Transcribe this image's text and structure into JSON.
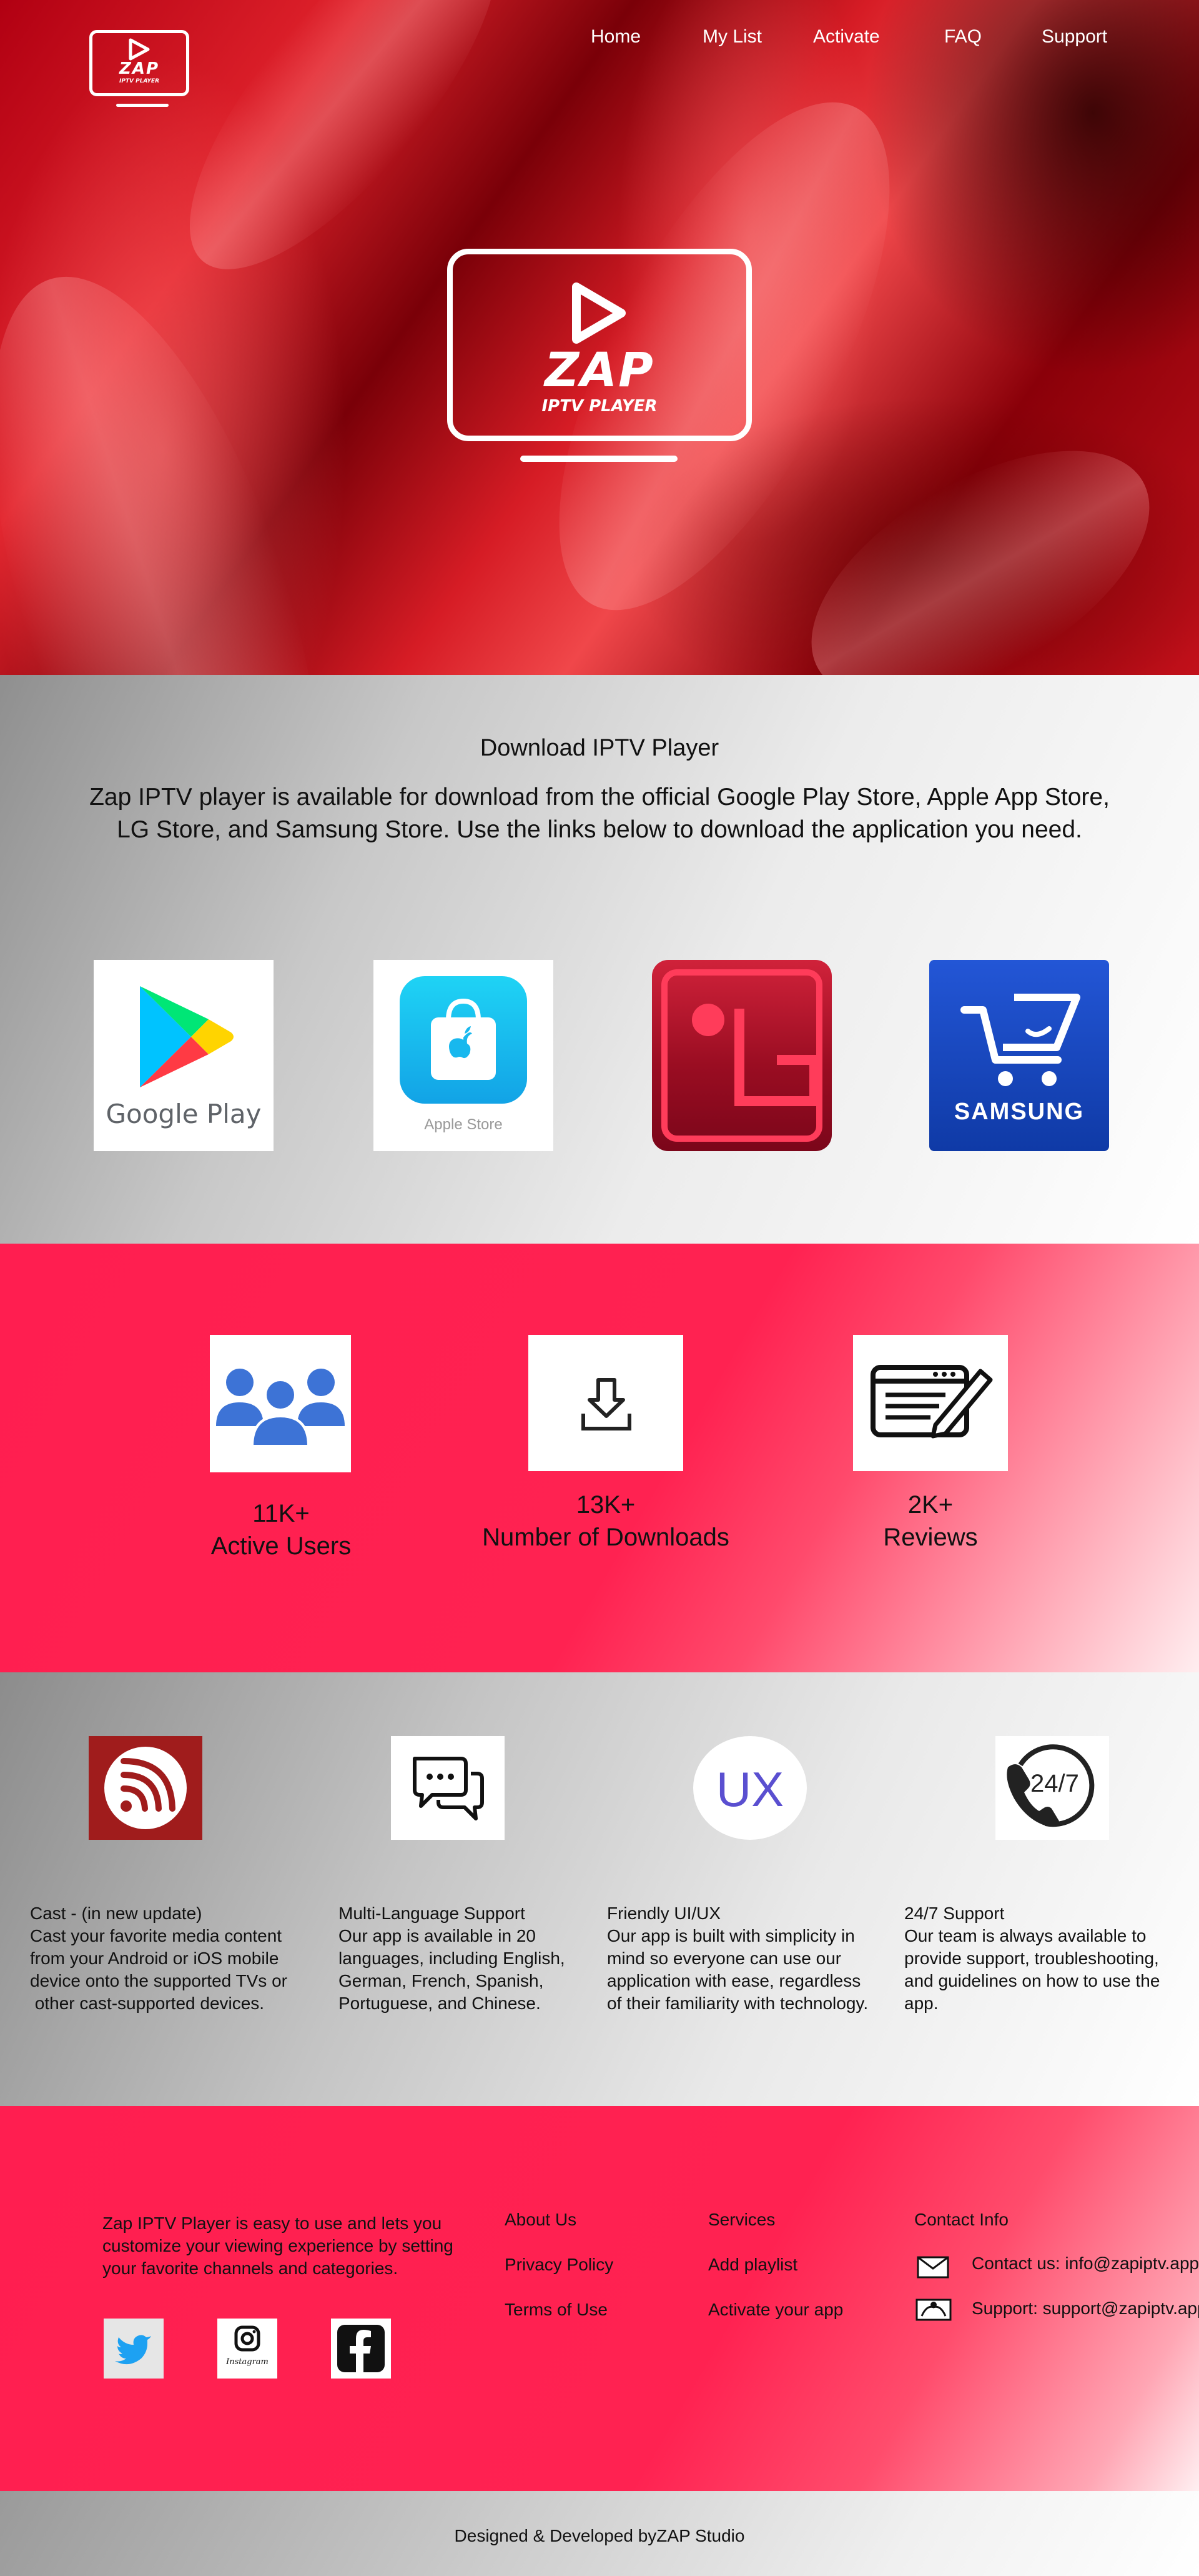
{
  "nav": {
    "items": [
      "Home",
      "My List",
      "Activate",
      "FAQ",
      "Support"
    ]
  },
  "logo": {
    "brand": "ZAP",
    "tagline": "IPTV PLAYER"
  },
  "download": {
    "title": "Download IPTV Player",
    "description_line1": "Zap IPTV player is available for download from the official Google Play Store, Apple App Store,",
    "description_line2": "LG Store, and Samsung Store. Use the links below to download the application you need.",
    "stores": {
      "google": "Google Play",
      "apple": "Apple Store",
      "lg": "LG Store",
      "samsung": "SAMSUNG"
    }
  },
  "stats": [
    {
      "value": "11K+",
      "label": "Active Users",
      "icon": "users-icon"
    },
    {
      "value": "13K+",
      "label": "Number of Downloads",
      "icon": "download-icon"
    },
    {
      "value": "2K+",
      "label": "Reviews",
      "icon": "review-icon"
    }
  ],
  "features": [
    {
      "title": "Cast - (in new update)",
      "lines": [
        "Cast your favorite media content",
        "from your Android or iOS mobile",
        "device onto the supported TVs or",
        " other cast-supported devices."
      ],
      "icon": "cast-icon"
    },
    {
      "title": "Multi-Language Support",
      "lines": [
        "Our app is available in 20",
        "languages, including English,",
        "German, French, Spanish,",
        "Portuguese, and Chinese."
      ],
      "icon": "chat-icon"
    },
    {
      "title": "Friendly UI/UX",
      "lines": [
        "Our app is built with simplicity in",
        "mind so everyone can use our",
        "application with ease, regardless",
        "of their familiarity with technology."
      ],
      "icon": "ux-icon",
      "icon_text": "UX"
    },
    {
      "title": "24/7 Support",
      "lines": [
        "Our team is always available to",
        "provide support, troubleshooting,",
        "and guidelines on how to use the",
        "app."
      ],
      "icon": "support-24-7-icon",
      "icon_text": "24/7"
    }
  ],
  "footer": {
    "about_lines": [
      "Zap IPTV Player is easy to use and lets you",
      "customize your viewing experience by setting",
      "your favorite channels and categories."
    ],
    "col1": [
      "About Us",
      "Privacy Policy",
      "Terms of Use"
    ],
    "col2": [
      "Services",
      "Add playlist",
      "Activate your app"
    ],
    "contact_heading": "Contact Info",
    "contact_email": "Contact us: info@zapiptv.app",
    "support_email": "Support: support@zapiptv.app",
    "social": {
      "instagram_label": "Instagram"
    }
  },
  "copyright": "Designed & Developed byZAP Studio",
  "colors": {
    "accent": "#ff1e50",
    "hero_red": "#d61c25",
    "google_blue": "#4285f4",
    "lg_red": "#b5102a",
    "samsung_blue": "#1a45b8",
    "icon_blue": "#3d73d6",
    "ux_purple": "#5a4fd0"
  }
}
